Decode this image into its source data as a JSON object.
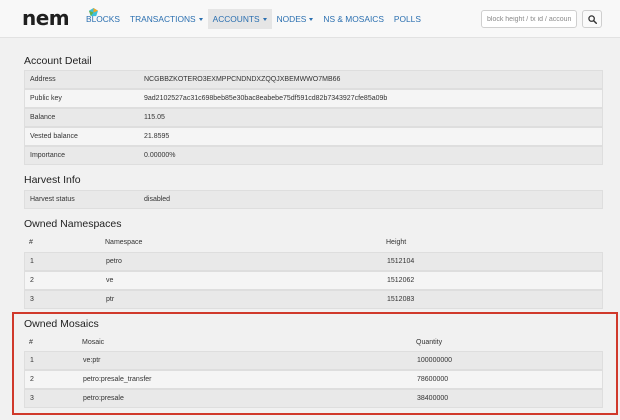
{
  "navbar": {
    "logo_text": "nem",
    "items": [
      {
        "label": "BLOCKS",
        "dropdown": false,
        "active": false
      },
      {
        "label": "TRANSACTIONS",
        "dropdown": true,
        "active": false
      },
      {
        "label": "ACCOUNTS",
        "dropdown": true,
        "active": true
      },
      {
        "label": "NODES",
        "dropdown": true,
        "active": false
      },
      {
        "label": "NS & MOSAICS",
        "dropdown": false,
        "active": false
      },
      {
        "label": "POLLS",
        "dropdown": false,
        "active": false
      }
    ],
    "search_placeholder": "block height / tx id / account",
    "search_icon": "search-icon"
  },
  "account_detail": {
    "title": "Account Detail",
    "rows": [
      {
        "key": "Address",
        "value": "NCGBBZKOTERO3EXMPPCNDNDXZQQJXBEMWWO7MB66"
      },
      {
        "key": "Public key",
        "value": "9ad2102527ac31c698beb85e30bac8eabebe75df591cd82b7343927cfe85a09b"
      },
      {
        "key": "Balance",
        "value": "115.05"
      },
      {
        "key": "Vested balance",
        "value": "21.8595"
      },
      {
        "key": "Importance",
        "value": "0.00000%"
      }
    ]
  },
  "harvest_info": {
    "title": "Harvest Info",
    "rows": [
      {
        "key": "Harvest status",
        "value": "disabled"
      }
    ]
  },
  "owned_namespaces": {
    "title": "Owned Namespaces",
    "headers": [
      "#",
      "Namespace",
      "Height"
    ],
    "rows": [
      [
        "1",
        "petro",
        "1512104"
      ],
      [
        "2",
        "ve",
        "1512062"
      ],
      [
        "3",
        "ptr",
        "1512083"
      ]
    ]
  },
  "owned_mosaics": {
    "title": "Owned Mosaics",
    "headers": [
      "#",
      "Mosaic",
      "Quantity"
    ],
    "rows": [
      [
        "1",
        "ve:ptr",
        "100000000"
      ],
      [
        "2",
        "petro:presale_transfer",
        "78600000"
      ],
      [
        "3",
        "petro:presale",
        "38400000"
      ]
    ]
  },
  "colors": {
    "link": "#2a6fb0",
    "highlight": "#d0392b",
    "logo_accent": "#3ec0d8"
  }
}
